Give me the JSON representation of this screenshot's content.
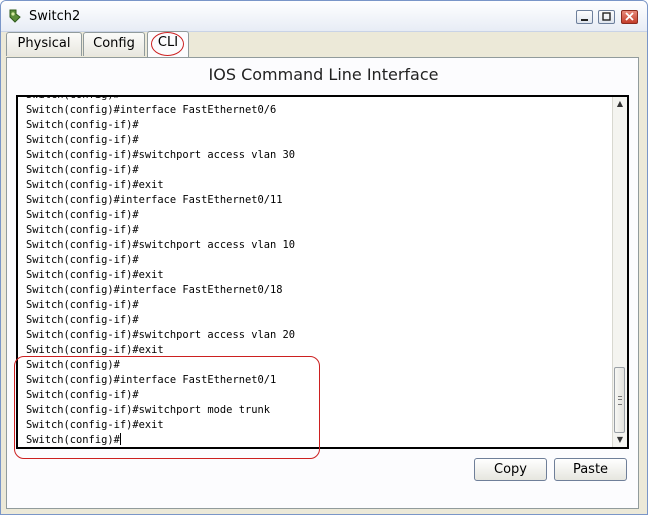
{
  "window": {
    "title": "Switch2"
  },
  "tabs": [
    {
      "label": "Physical"
    },
    {
      "label": "Config"
    },
    {
      "label": "CLI"
    }
  ],
  "cli": {
    "heading": "IOS Command Line Interface",
    "lines": [
      "Switch(config)#",
      "Switch(config)#interface FastEthernet0/6",
      "Switch(config-if)#",
      "Switch(config-if)#",
      "Switch(config-if)#switchport access vlan 30",
      "Switch(config-if)#",
      "Switch(config-if)#exit",
      "Switch(config)#interface FastEthernet0/11",
      "Switch(config-if)#",
      "Switch(config-if)#",
      "Switch(config-if)#switchport access vlan 10",
      "Switch(config-if)#",
      "Switch(config-if)#exit",
      "Switch(config)#interface FastEthernet0/18",
      "Switch(config-if)#",
      "Switch(config-if)#",
      "Switch(config-if)#switchport access vlan 20",
      "Switch(config-if)#exit",
      "Switch(config)#",
      "Switch(config)#interface FastEthernet0/1",
      "Switch(config-if)#",
      "Switch(config-if)#switchport mode trunk",
      "Switch(config-if)#exit",
      "Switch(config)#"
    ]
  },
  "buttons": {
    "copy": "Copy",
    "paste": "Paste"
  },
  "annotation_color": "#cc2020"
}
